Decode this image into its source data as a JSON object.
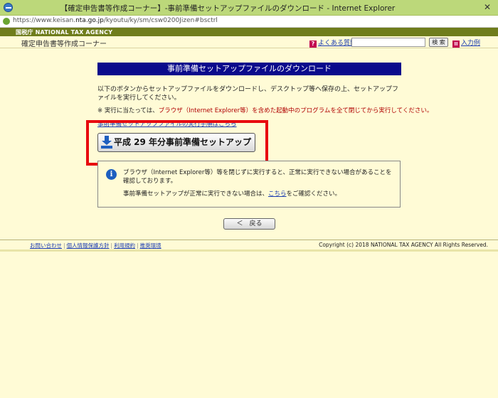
{
  "window": {
    "title": "【確定申告書等作成コーナー】-事前準備セットアップファイルのダウンロード - Internet Explorer",
    "close_glyph": "✕"
  },
  "address": {
    "url_prefix": "https://www.keisan.",
    "url_domain": "nta.go.jp",
    "url_path": "/kyoutu/ky/sm/csw0200Jizen#bsctrl"
  },
  "header": {
    "agency": "国税庁 NATIONAL TAX AGENCY",
    "corner_title": "確定申告書等作成コーナー",
    "faq_label": "よくある質問",
    "search_value": "",
    "search_button": "検 索",
    "input_help_label": "入力例"
  },
  "main": {
    "page_title": "事前準備セットアップファイルのダウンロード",
    "intro": "以下のボタンからセットアップファイルをダウンロードし、デスクトップ等へ保存の上、セットアップファイルを実行してください。",
    "note_prefix": "※ 実行に当たっては、",
    "note_red": "ブラウザ（Internet Explorer等）を含めた起動中のプログラムを全て閉じてから実行してください。",
    "hidden_link": "事前準備セットアップファイルの実行手順はこちら",
    "setup_button": "平成 29 年分事前準備セットアップ",
    "info_line1": "ブラウザ（Internet Explorer等）等を閉じずに実行すると、正常に実行できない場合があることを確認しております。",
    "info_line2_prefix": "事前準備セットアップが正常に実行できない場合は、",
    "info_link": "こちら",
    "info_line2_suffix": "をご確認ください。",
    "back_button": "＜　戻る"
  },
  "footer": {
    "links": [
      "お問い合わせ",
      "個人情報保護方針",
      "利用規約",
      "推奨環境"
    ],
    "separator": "|",
    "copyright": "Copyright (c) 2018 NATIONAL TAX AGENCY All Rights Reserved."
  },
  "colors": {
    "title_bar": "#bcd87a",
    "agency_band": "#6f7d1c",
    "page_background": "#fffbd6",
    "heading_band": "#0a0a8c",
    "highlight": "#e8090f",
    "link": "#1a3bb0",
    "note_red": "#b00000"
  },
  "icons": [
    "app-ie-icon",
    "lock-icon",
    "question-icon",
    "input-example-icon",
    "download-icon",
    "info-icon"
  ]
}
